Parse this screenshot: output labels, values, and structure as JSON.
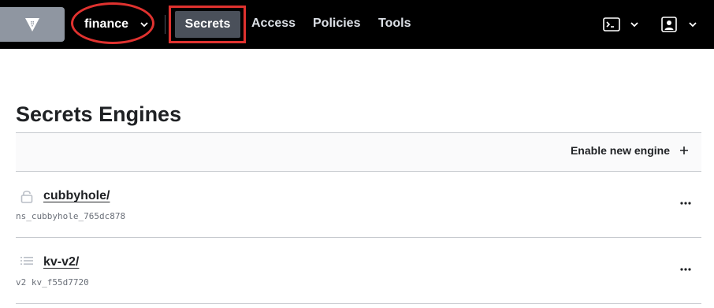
{
  "header": {
    "namespace": {
      "label": "finance"
    },
    "nav": [
      {
        "label": "Secrets",
        "active": true
      },
      {
        "label": "Access"
      },
      {
        "label": "Policies"
      },
      {
        "label": "Tools"
      }
    ],
    "icons": {
      "logo": "vault-logo-icon",
      "console": "terminal-icon",
      "user": "user-icon"
    }
  },
  "main": {
    "title": "Secrets Engines",
    "enable_label": "Enable new engine",
    "engines": [
      {
        "name": "cubbyhole/",
        "accessor": "ns_cubbyhole_765dc878",
        "icon": "lock-icon"
      },
      {
        "name": "kv-v2/",
        "accessor": "v2 kv_f55d7720",
        "icon": "list-icon"
      }
    ]
  },
  "colors": {
    "header_bg": "#000000",
    "highlight": "#e0322f",
    "active_tab": "#4a505a"
  }
}
